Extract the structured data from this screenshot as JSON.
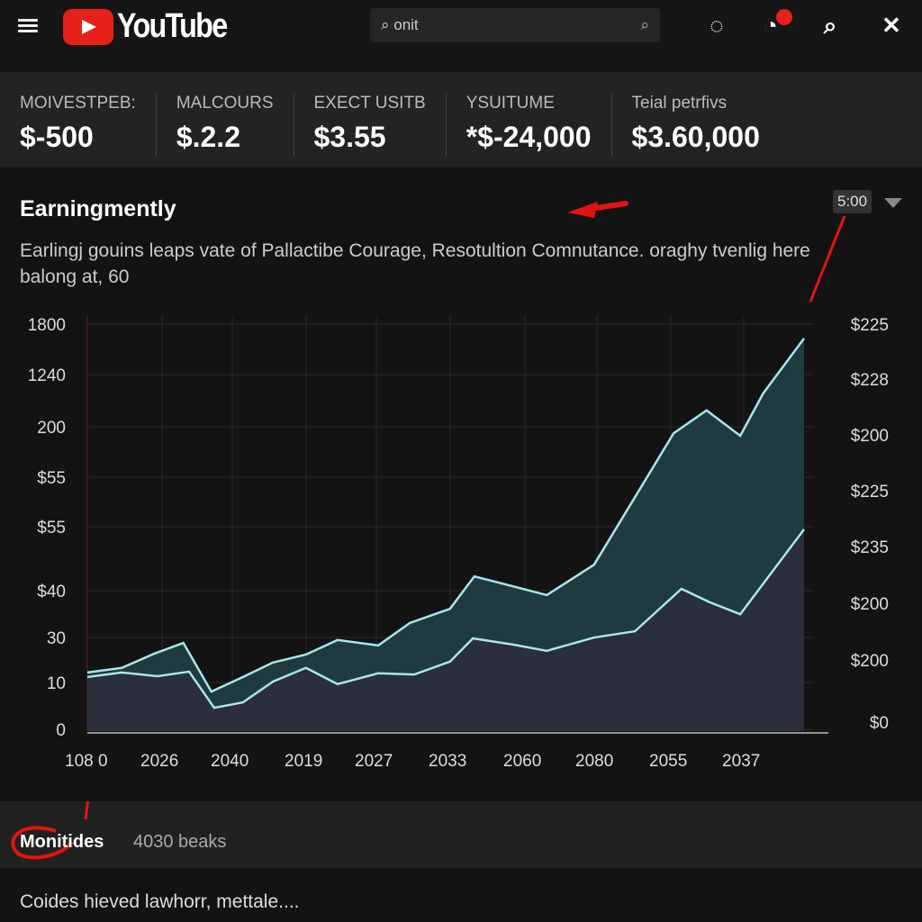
{
  "header": {
    "logo": "YouTube",
    "search_value": "onit"
  },
  "stats": [
    {
      "label": "MOIVESTPEB:",
      "value": "$-500"
    },
    {
      "label": "MALCOURS",
      "value": "$.2.2"
    },
    {
      "label": "EXECT USITB",
      "value": "$3.55"
    },
    {
      "label": "YSUITUME",
      "value": "*$-24,000"
    },
    {
      "label": "Teial petrfivs",
      "value": "$3.60,000"
    }
  ],
  "section": {
    "title": "Earningmently",
    "description": "Earlingj gouins leaps vate of Pallactibe Courage, Resotultion Comnutance. oraghy tvenlig here balong at, 60",
    "time_chip": "5:00"
  },
  "chart_data": {
    "type": "area",
    "x_tick_labels": [
      "108 0",
      "2026",
      "2040",
      "2019",
      "2027",
      "2033",
      "2060",
      "2080",
      "2055",
      "2037"
    ],
    "y_left_tick_labels": [
      "1800",
      "1240",
      "200",
      "$55",
      "$55",
      "$40",
      "30",
      "10",
      "0"
    ],
    "y_right_tick_labels": [
      "$225",
      "$228",
      "$200",
      "$225",
      "$235",
      "$200",
      "$200",
      "$0"
    ],
    "value_units": "percent of plot width (x) and height (y)",
    "ylim": [
      0,
      100
    ],
    "grid": true,
    "series": [
      {
        "color": "#a8e6ea",
        "fill": "#1f3b40",
        "x": [
          0,
          4.8,
          9.3,
          13.4,
          17.3,
          21.7,
          25.9,
          30.5,
          34.9,
          40.6,
          45.0,
          50.6,
          54.0,
          59.4,
          64.1,
          70.7,
          75.8,
          81.8,
          86.4,
          91.1,
          94.3,
          100
        ],
        "y": [
          14.1,
          15.2,
          18.6,
          21.2,
          9.5,
          13.0,
          16.5,
          18.4,
          21.9,
          20.6,
          26.0,
          29.4,
          37.2,
          34.8,
          32.7,
          40.0,
          54.5,
          71.6,
          77.1,
          71.0,
          81.2,
          94.4
        ]
      },
      {
        "color": "#a8e6ea",
        "fill": "#2b2e3b",
        "x": [
          0,
          4.8,
          9.8,
          14.2,
          17.7,
          21.7,
          25.9,
          30.5,
          34.9,
          40.6,
          45.6,
          50.6,
          53.8,
          59.4,
          64.1,
          70.7,
          76.4,
          82.9,
          86.8,
          91.1,
          100
        ],
        "y": [
          13.0,
          14.1,
          13.2,
          14.3,
          5.6,
          6.9,
          11.9,
          15.2,
          11.3,
          13.9,
          13.6,
          16.7,
          22.3,
          20.8,
          19.3,
          22.5,
          24.0,
          34.2,
          31.0,
          28.1,
          48.5
        ]
      }
    ]
  },
  "bottom": {
    "label": "Monitides",
    "count": "4030 beaks",
    "footer": "Coides hieved lawhorr, mettale...."
  }
}
